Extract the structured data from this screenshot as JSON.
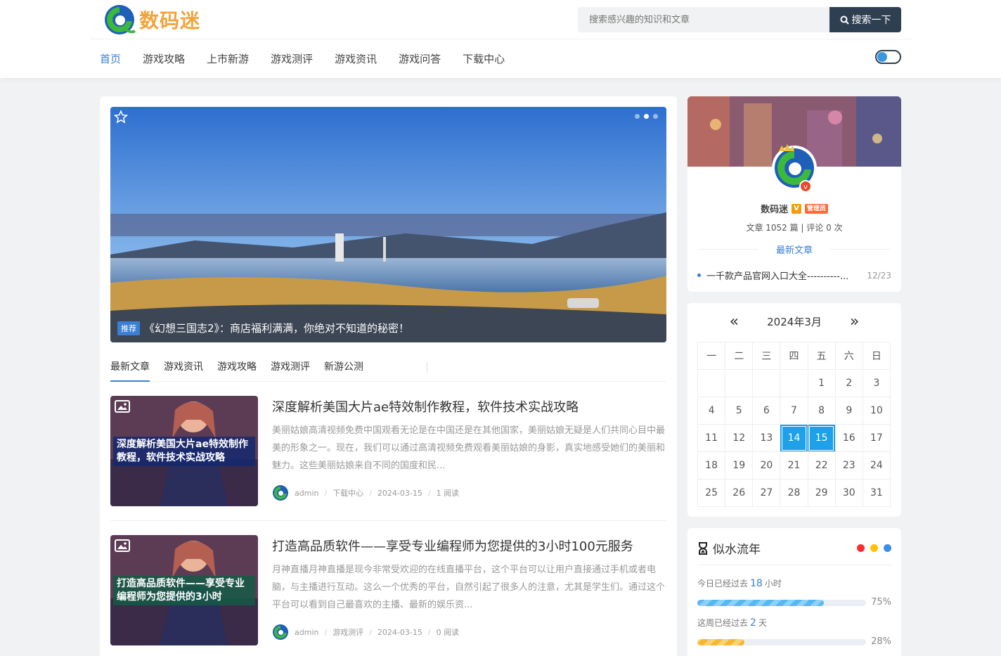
{
  "header": {
    "logo_text": "数码迷",
    "search_placeholder": "搜索感兴趣的知识和文章",
    "search_button": "搜索一下",
    "nav": [
      "首页",
      "游戏攻略",
      "上市新游",
      "游戏测评",
      "游戏资讯",
      "游戏问答",
      "下载中心"
    ]
  },
  "banner": {
    "tag": "推荐",
    "caption": "《幻想三国志2》：商店福利满满，你绝对不知道的秘密！"
  },
  "tabs": [
    "最新文章",
    "游戏资讯",
    "游戏攻略",
    "游戏测评",
    "新游公测"
  ],
  "posts": [
    {
      "thumb_title": "深度解析美国大片ae特效制作教程，软件技术实战攻略",
      "title": "深度解析美国大片ae特效制作教程，软件技术实战攻略",
      "desc": "美丽姑娘高清视频免费中国观看无论是在中国还是在其他国家，美丽姑娘无疑是人们共同心目中最美的形象之一。现在，我们可以通过高清视频免费观看美丽姑娘的身影，真实地感受她们的美丽和魅力。这些美丽姑娘来自不同的国度和民...",
      "author": "admin",
      "category": "下载中心",
      "date": "2024-03-15",
      "reads": "1 阅读"
    },
    {
      "thumb_title": "打造高品质软件——享受专业编程师为您提供的3小时",
      "title": "打造高品质软件——享受专业编程师为您提供的3小时100元服务",
      "desc": "月神直播月神直播是现今非常受欢迎的在线直播平台，这个平台可以让用户直接通过手机或者电脑，与主播进行互动。这么一个优秀的平台，自然引起了很多人的注意，尤其是学生们。通过这个平台可以看到自己最喜欢的主播、最新的娱乐资...",
      "author": "admin",
      "category": "游戏测评",
      "date": "2024-03-15",
      "reads": "0 阅读"
    }
  ],
  "profile": {
    "name": "数码迷",
    "badge_v": "V",
    "badge_role": "管理员",
    "stats": "文章 1052 篇 | 评论 0 次",
    "latest_heading": "最新文章",
    "latest_item": "一千款产品官网入口大全----------...",
    "latest_date": "12/23"
  },
  "calendar": {
    "prev": "«",
    "next": "»",
    "title": "2024年3月",
    "weekdays": [
      "一",
      "二",
      "三",
      "四",
      "五",
      "六",
      "日"
    ],
    "weeks": [
      [
        "",
        "",
        "",
        "",
        "1",
        "2",
        "3"
      ],
      [
        "4",
        "5",
        "6",
        "7",
        "8",
        "9",
        "10"
      ],
      [
        "11",
        "12",
        "13",
        "14",
        "15",
        "16",
        "17"
      ],
      [
        "18",
        "19",
        "20",
        "21",
        "22",
        "23",
        "24"
      ],
      [
        "25",
        "26",
        "27",
        "28",
        "29",
        "30",
        "31"
      ]
    ],
    "highlighted": [
      "14",
      "15"
    ]
  },
  "time": {
    "title": "似水流年",
    "dot_colors": [
      "#ff2d2d",
      "#ffc107",
      "#3a8ee6"
    ],
    "today_prefix": "今日已经过去",
    "today_value": "18",
    "today_unit": "小时",
    "today_pct": "75%",
    "today_frac": 0.75,
    "week_prefix": "这周已经过去",
    "week_value": "2",
    "week_unit": "天",
    "week_pct": "28%",
    "week_frac": 0.28
  }
}
